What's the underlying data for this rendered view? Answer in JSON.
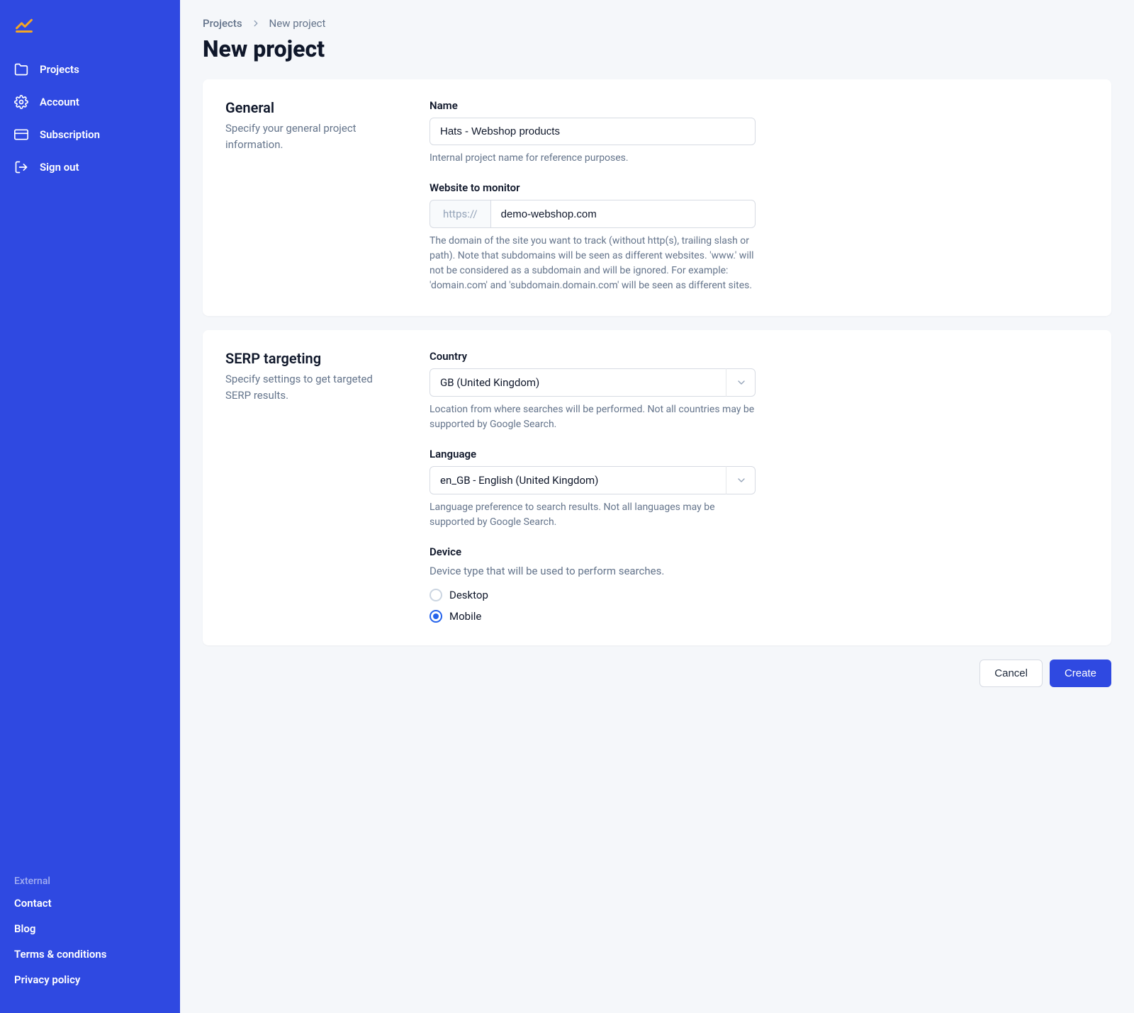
{
  "sidebar": {
    "nav": [
      {
        "label": "Projects"
      },
      {
        "label": "Account"
      },
      {
        "label": "Subscription"
      },
      {
        "label": "Sign out"
      }
    ],
    "external_label": "External",
    "external_links": [
      {
        "label": "Contact"
      },
      {
        "label": "Blog"
      },
      {
        "label": "Terms & conditions"
      },
      {
        "label": "Privacy policy"
      }
    ]
  },
  "breadcrumb": {
    "root": "Projects",
    "current": "New project"
  },
  "page_title": "New project",
  "general": {
    "title": "General",
    "desc": "Specify your general project information.",
    "name_label": "Name",
    "name_value": "Hats - Webshop products",
    "name_helper": "Internal project name for reference purposes.",
    "website_label": "Website to monitor",
    "website_prefix": "https://",
    "website_value": "demo-webshop.com",
    "website_helper": "The domain of the site you want to track (without http(s), trailing slash or path). Note that subdomains will be seen as different websites. 'www.' will not be considered as a subdomain and will be ignored. For example: 'domain.com' and 'subdomain.domain.com' will be seen as different sites."
  },
  "serp": {
    "title": "SERP targeting",
    "desc": "Specify settings to get targeted SERP results.",
    "country_label": "Country",
    "country_value": "GB (United Kingdom)",
    "country_helper": "Location from where searches will be performed. Not all countries may be supported by Google Search.",
    "language_label": "Language",
    "language_value": "en_GB - English (United Kingdom)",
    "language_helper": "Language preference to search results. Not all languages may be supported by Google Search.",
    "device_label": "Device",
    "device_sublabel": "Device type that will be used to perform searches.",
    "device_options": {
      "desktop": "Desktop",
      "mobile": "Mobile"
    }
  },
  "actions": {
    "cancel": "Cancel",
    "create": "Create"
  }
}
